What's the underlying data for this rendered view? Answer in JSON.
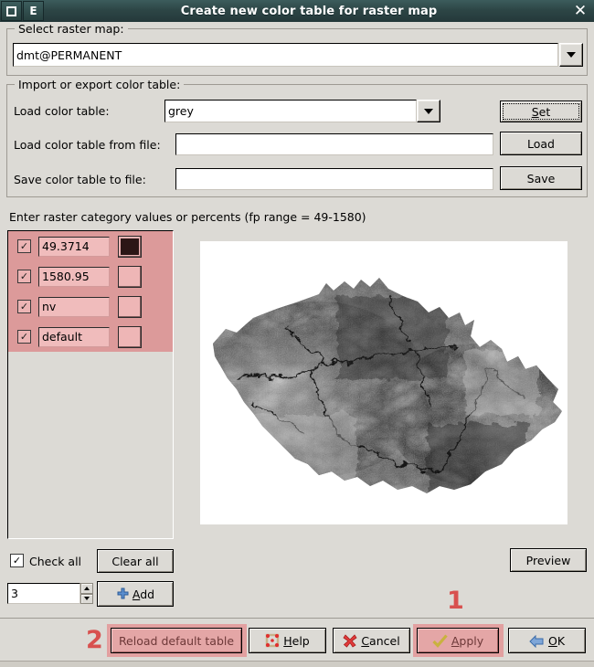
{
  "window": {
    "title": "Create new color table for raster map",
    "titlebar_buttons": [
      {
        "name": "restore",
        "glyph": "□"
      },
      {
        "name": "menu-e",
        "glyph": "E"
      }
    ],
    "close_glyph": "✕"
  },
  "select_raster": {
    "group_title": "Select raster map:",
    "value": "dmt@PERMANENT",
    "placeholder": ""
  },
  "import_export": {
    "group_title": "Import or export color table:",
    "load_table_label": "Load color table:",
    "load_table_value": "grey",
    "set_button": "Set",
    "load_file_label": "Load color table from file:",
    "load_file_value": "",
    "load_button": "Load",
    "save_file_label": "Save color table to file:",
    "save_file_value": "",
    "save_button": "Save"
  },
  "categories": {
    "header": "Enter raster category values or percents (fp range = 49-1580)",
    "rows": [
      {
        "checked": true,
        "value": "49.3714",
        "color": "#2b1616",
        "has_color": true
      },
      {
        "checked": true,
        "value": "1580.95",
        "color": "",
        "has_color": false
      },
      {
        "checked": true,
        "value": "nv",
        "color": "",
        "has_color": false
      },
      {
        "checked": true,
        "value": "default",
        "color": "",
        "has_color": false
      }
    ],
    "check_mark": "✓",
    "check_all_label": "Check all",
    "clear_all_label": "Clear all",
    "spin_value": "3",
    "add_label": "Add",
    "highlight_color": "#dc9a9a"
  },
  "preview": {
    "button_label": "Preview",
    "image_alt": "grayscale digital elevation model of the Czech Republic"
  },
  "footer": {
    "reload_label": "Reload default table",
    "help_label": "Help",
    "cancel_label": "Cancel",
    "apply_label": "Apply",
    "ok_label": "OK",
    "markers": [
      {
        "text": "1",
        "target": "apply-button"
      },
      {
        "text": "2",
        "target": "reload-default-table-button"
      }
    ],
    "marker_color": "#d8514f",
    "highlight_color": "#e2a0a0"
  }
}
